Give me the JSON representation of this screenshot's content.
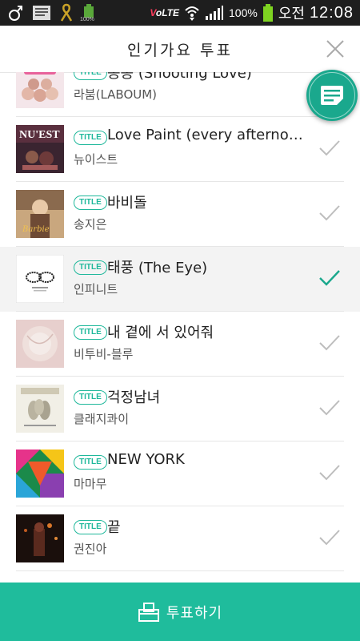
{
  "status_bar": {
    "volte": "VoLTE",
    "battery_percent": "100%",
    "ampm": "오전",
    "time": "12:08",
    "small_battery_text": "100%"
  },
  "header": {
    "title": "인기가요 투표"
  },
  "badge_label": "TITLE",
  "songs": [
    {
      "title": "퐁퐁 (Shooting Love)",
      "artist": "라붐(LABOUM)",
      "selected": false
    },
    {
      "title": "Love Paint (every afternoon)",
      "artist": "뉴이스트",
      "selected": false
    },
    {
      "title": "바비돌",
      "artist": "송지은",
      "selected": false
    },
    {
      "title": "태풍 (The Eye)",
      "artist": "인피니트",
      "selected": true
    },
    {
      "title": "내 곁에 서 있어줘",
      "artist": "비투비-블루",
      "selected": false
    },
    {
      "title": "걱정남녀",
      "artist": "클래지콰이",
      "selected": false
    },
    {
      "title": "NEW YORK",
      "artist": "마마무",
      "selected": false
    },
    {
      "title": "끝",
      "artist": "권진아",
      "selected": false
    }
  ],
  "footer": {
    "vote_label": "투표하기"
  },
  "colors": {
    "accent": "#1fbc9c",
    "check_inactive": "#bdbdbd",
    "check_active": "#1aa88d"
  },
  "icons": {
    "close": "close-icon",
    "check": "check-icon",
    "list": "list-icon",
    "vote": "ballot-box-icon"
  }
}
